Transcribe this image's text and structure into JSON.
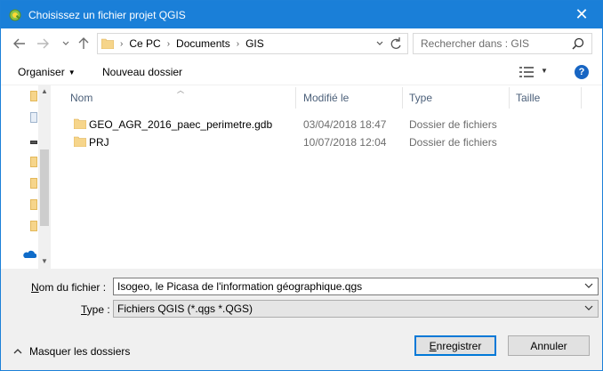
{
  "window": {
    "title": "Choisissez un fichier projet QGIS",
    "close_label": "✕"
  },
  "navigation": {
    "back_icon": "arrow-left-icon",
    "forward_icon": "arrow-right-icon",
    "recent_icon": "chevron-down-icon",
    "up_icon": "arrow-up-icon",
    "breadcrumb": [
      "Ce PC",
      "Documents",
      "GIS"
    ],
    "refresh_icon": "refresh-icon"
  },
  "search": {
    "placeholder": "Rechercher dans : GIS"
  },
  "toolbar": {
    "organize_label": "Organiser",
    "new_folder_label": "Nouveau dossier",
    "help_label": "?"
  },
  "columns": {
    "name": "Nom",
    "modified": "Modifié le",
    "type": "Type",
    "size": "Taille"
  },
  "files": [
    {
      "name": "GEO_AGR_2016_paec_perimetre.gdb",
      "modified": "03/04/2018 18:47",
      "type": "Dossier de fichiers"
    },
    {
      "name": "PRJ",
      "modified": "10/07/2018 12:04",
      "type": "Dossier de fichiers"
    }
  ],
  "form": {
    "filename_label_u": "N",
    "filename_label_rest": "om du fichier :",
    "filename_value": "Isogeo, le Picasa de l'information géographique.qgs",
    "type_label_u": "T",
    "type_label_rest": "ype :",
    "type_value": "Fichiers QGIS (*.qgs *.QGS)",
    "hide_folders_label": "Masquer les dossiers",
    "save_label_u": "E",
    "save_label_rest": "nregistrer",
    "cancel_label": "Annuler"
  },
  "colors": {
    "titlebar": "#1a7fd8",
    "folder": "#f6d58b",
    "help": "#1765c3",
    "primary_border": "#0078d7"
  }
}
